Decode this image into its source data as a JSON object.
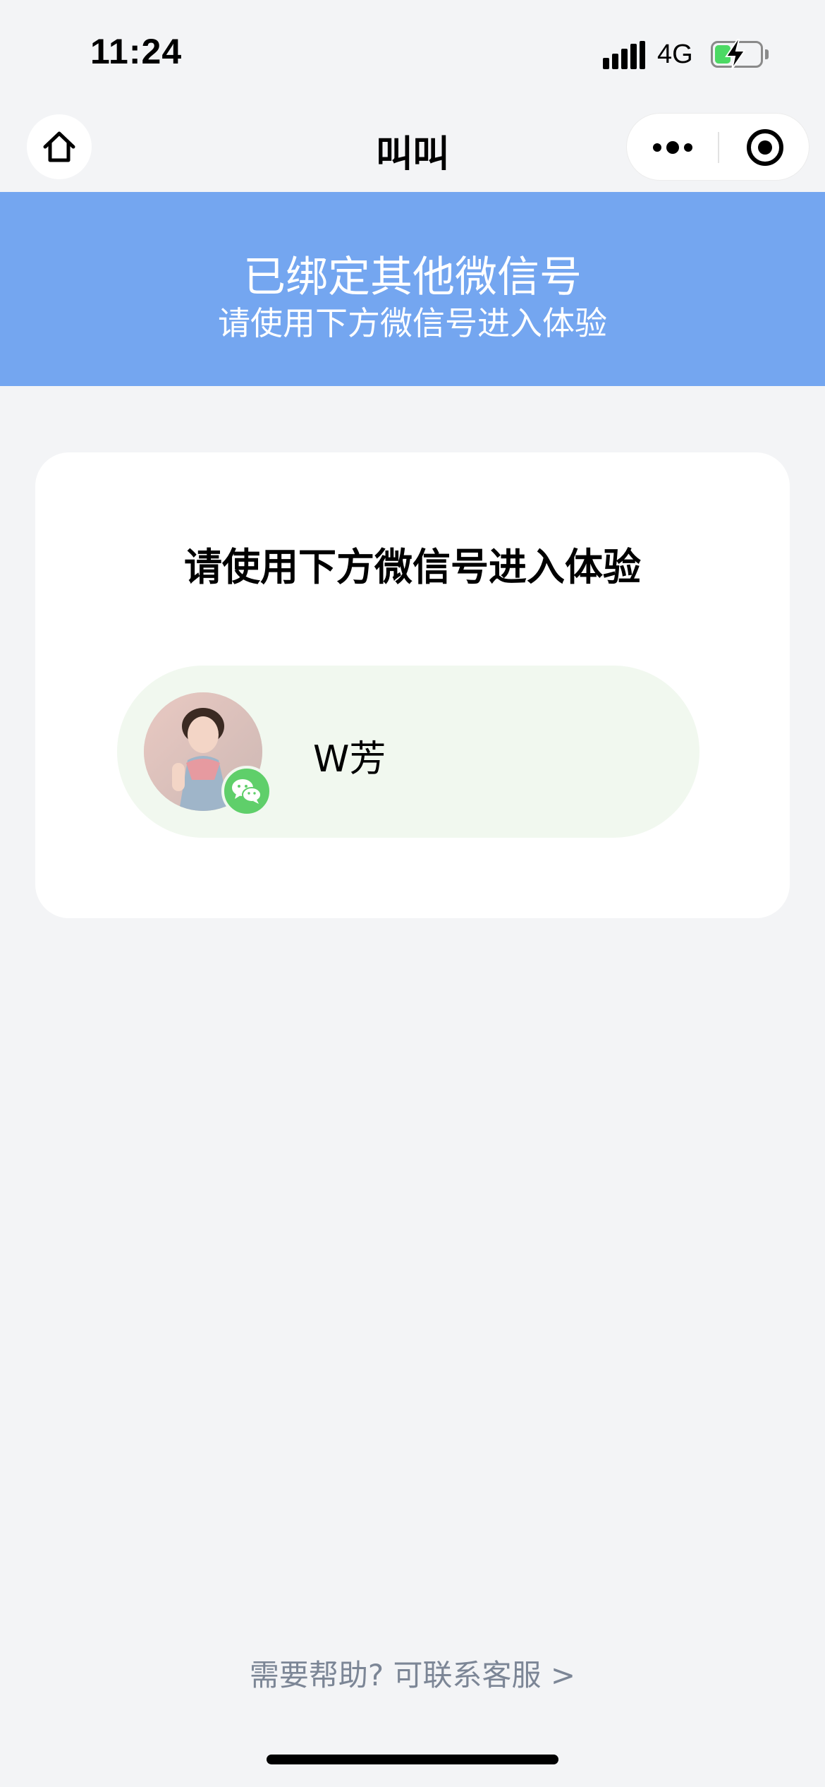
{
  "status_bar": {
    "time": "11:24",
    "network": "4G",
    "battery_level": 0.35,
    "battery_color": "#4cd964",
    "charging": true,
    "signal_icon": "signal-bars-icon",
    "battery_icon": "battery-charging-icon"
  },
  "nav": {
    "title": "叫叫",
    "home_icon": "home-icon",
    "more_icon": "more-dots-icon",
    "close_icon": "target-close-icon"
  },
  "banner": {
    "title": "已绑定其他微信号",
    "subtitle": "请使用下方微信号进入体验",
    "background": "#74a6f0"
  },
  "card": {
    "title": "请使用下方微信号进入体验",
    "account": {
      "name": "W芳",
      "avatar_icon": "avatar-photo",
      "badge_icon": "wechat-icon",
      "badge_color": "#5fcf6a",
      "pill_color": "#f1f8ef"
    }
  },
  "footer": {
    "help_text": "需要帮助? 可联系客服 >"
  }
}
